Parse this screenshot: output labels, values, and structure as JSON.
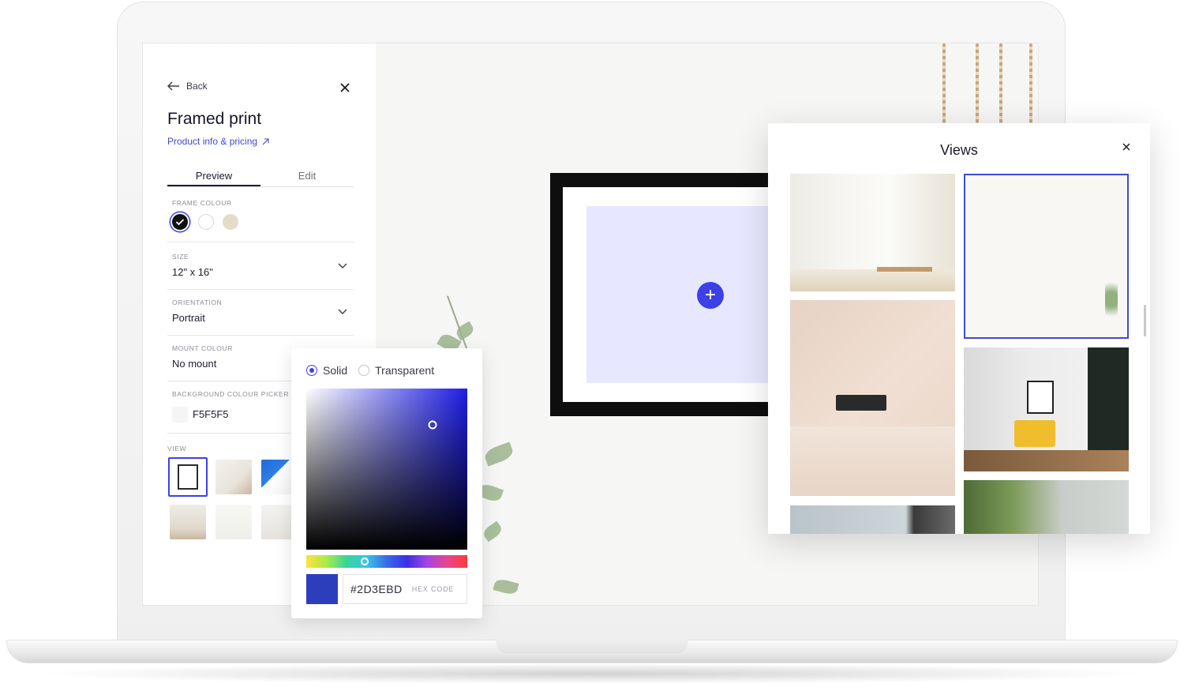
{
  "panel": {
    "back_label": "Back",
    "title": "Framed print",
    "subtitle": "Product info & pricing",
    "tabs": [
      {
        "label": "Preview",
        "active": true
      },
      {
        "label": "Edit",
        "active": false
      }
    ],
    "frame_colour": {
      "label": "FRAME COLOUR",
      "options": [
        {
          "color": "#111111",
          "selected": true
        },
        {
          "color": "#ffffff",
          "selected": false
        },
        {
          "color": "#e4dcc8",
          "selected": false
        }
      ]
    },
    "size": {
      "label": "SIZE",
      "value": "12\" x 16\""
    },
    "orientation": {
      "label": "ORIENTATION",
      "value": "Portrait"
    },
    "mount_colour": {
      "label": "MOUNT COLOUR",
      "value": "No mount"
    },
    "background_picker": {
      "label": "BACKGROUND COLOUR PICKER",
      "value": "F5F5F5",
      "color": "#F5F5F5"
    },
    "view": {
      "label": "VIEW"
    }
  },
  "picker": {
    "modes": [
      {
        "label": "Solid",
        "selected": true
      },
      {
        "label": "Transparent",
        "selected": false
      }
    ],
    "hex_value": "#2D3EBD",
    "hex_hint": "HEX CODE",
    "swatch_color": "#2D3EBD"
  },
  "views": {
    "title": "Views"
  },
  "colors": {
    "accent": "#3D40E6",
    "link": "#3D4BCF",
    "art_placeholder": "#E7E8FF"
  }
}
